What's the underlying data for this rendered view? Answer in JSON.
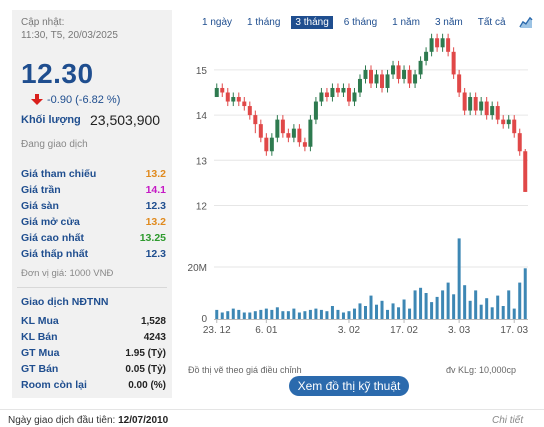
{
  "summary": {
    "updated_label": "Cập nhật:",
    "updated_time": "11:30, T5, 20/03/2025",
    "price": "12.30",
    "change": "-0.90 (-6.82 %)",
    "volume_label": "Khối lượng",
    "volume_value": "23,503,900",
    "status": "Đang giao dịch"
  },
  "prices": [
    {
      "label": "Giá tham chiếu",
      "value": "13.2",
      "color": "#e08a1e"
    },
    {
      "label": "Giá trần",
      "value": "14.1",
      "color": "#c518c5"
    },
    {
      "label": "Giá sàn",
      "value": "12.3",
      "color": "#1f4e8f"
    },
    {
      "label": "Giá mở cửa",
      "value": "13.2",
      "color": "#e08a1e"
    },
    {
      "label": "Giá cao nhất",
      "value": "13.25",
      "color": "#2e9a2e"
    },
    {
      "label": "Giá thấp nhất",
      "value": "12.3",
      "color": "#1f4e8f"
    }
  ],
  "unit_note": "Đơn vị giá: 1000 VNĐ",
  "foreign": {
    "title": "Giao dịch NĐTNN",
    "rows": [
      {
        "label": "KL Mua",
        "value": "1,528"
      },
      {
        "label": "KL Bán",
        "value": "4243"
      },
      {
        "label": "GT Mua",
        "value": "1.95 (Tỷ)"
      },
      {
        "label": "GT Bán",
        "value": "0.05 (Tỷ)"
      },
      {
        "label": "Room còn lại",
        "value": "0.00 (%)"
      }
    ]
  },
  "tabs": [
    {
      "label": "1 ngày",
      "active": false
    },
    {
      "label": "1 tháng",
      "active": false
    },
    {
      "label": "3 tháng",
      "active": true
    },
    {
      "label": "6 tháng",
      "active": false
    },
    {
      "label": "1 năm",
      "active": false
    },
    {
      "label": "3 năm",
      "active": false
    },
    {
      "label": "Tất cả",
      "active": false
    }
  ],
  "chart_icon": "line-chart-icon",
  "chart_data": {
    "type": "candlestick",
    "y_ticks": [
      "15",
      "14",
      "13",
      "12"
    ],
    "y_range": [
      11.9,
      15.75
    ],
    "volume_tick": "20M",
    "volume_zero": "0",
    "volume_max_millions": 35,
    "x_ticks": [
      {
        "label": "23. 12",
        "index": 0
      },
      {
        "label": "6. 01",
        "index": 9
      },
      {
        "label": "3. 02",
        "index": 24
      },
      {
        "label": "17. 02",
        "index": 34
      },
      {
        "label": "3. 03",
        "index": 44
      },
      {
        "label": "17. 03",
        "index": 54
      }
    ],
    "up_color": "#2e7a4f",
    "down_color": "#e04848",
    "volume_color": "#3d87b4",
    "candles": [
      [
        14.4,
        14.6,
        14.4,
        14.7
      ],
      [
        14.6,
        14.5,
        14.4,
        14.7
      ],
      [
        14.5,
        14.3,
        14.2,
        14.6
      ],
      [
        14.3,
        14.4,
        14.2,
        14.5
      ],
      [
        14.4,
        14.3,
        14.2,
        14.5
      ],
      [
        14.3,
        14.2,
        14.1,
        14.4
      ],
      [
        14.2,
        14.0,
        13.9,
        14.3
      ],
      [
        14.0,
        13.8,
        13.6,
        14.1
      ],
      [
        13.8,
        13.5,
        13.4,
        13.9
      ],
      [
        13.5,
        13.2,
        13.1,
        13.6
      ],
      [
        13.2,
        13.5,
        13.1,
        13.6
      ],
      [
        13.5,
        13.9,
        13.4,
        14.0
      ],
      [
        13.9,
        13.6,
        13.5,
        14.0
      ],
      [
        13.6,
        13.5,
        13.4,
        13.7
      ],
      [
        13.5,
        13.7,
        13.4,
        13.8
      ],
      [
        13.7,
        13.4,
        13.3,
        13.8
      ],
      [
        13.4,
        13.3,
        13.2,
        13.5
      ],
      [
        13.3,
        13.9,
        13.2,
        14.0
      ],
      [
        13.9,
        14.3,
        13.8,
        14.4
      ],
      [
        14.3,
        14.5,
        14.2,
        14.6
      ],
      [
        14.5,
        14.4,
        14.3,
        14.6
      ],
      [
        14.4,
        14.6,
        14.3,
        14.7
      ],
      [
        14.6,
        14.5,
        14.4,
        14.7
      ],
      [
        14.5,
        14.6,
        14.4,
        14.7
      ],
      [
        14.6,
        14.3,
        14.2,
        14.7
      ],
      [
        14.3,
        14.5,
        14.2,
        14.6
      ],
      [
        14.5,
        14.8,
        14.4,
        14.9
      ],
      [
        14.8,
        15.0,
        14.7,
        15.1
      ],
      [
        15.0,
        14.7,
        14.6,
        15.1
      ],
      [
        14.7,
        14.9,
        14.6,
        15.0
      ],
      [
        14.9,
        14.6,
        14.5,
        15.0
      ],
      [
        14.6,
        14.9,
        14.5,
        15.0
      ],
      [
        14.9,
        15.1,
        14.8,
        15.2
      ],
      [
        15.1,
        14.8,
        14.7,
        15.2
      ],
      [
        14.8,
        15.0,
        14.7,
        15.1
      ],
      [
        15.0,
        14.7,
        14.6,
        15.1
      ],
      [
        14.7,
        14.9,
        14.6,
        15.0
      ],
      [
        14.9,
        15.2,
        14.8,
        15.3
      ],
      [
        15.2,
        15.4,
        15.1,
        15.5
      ],
      [
        15.4,
        15.7,
        15.3,
        15.8
      ],
      [
        15.7,
        15.5,
        15.4,
        15.8
      ],
      [
        15.5,
        15.7,
        15.4,
        15.8
      ],
      [
        15.7,
        15.4,
        15.3,
        15.8
      ],
      [
        15.4,
        14.9,
        14.8,
        15.5
      ],
      [
        14.9,
        14.5,
        14.4,
        15.0
      ],
      [
        14.5,
        14.1,
        14.0,
        14.6
      ],
      [
        14.1,
        14.4,
        14.0,
        14.5
      ],
      [
        14.4,
        14.1,
        14.0,
        14.5
      ],
      [
        14.1,
        14.3,
        14.0,
        14.4
      ],
      [
        14.3,
        14.0,
        13.9,
        14.4
      ],
      [
        14.0,
        14.2,
        13.9,
        14.3
      ],
      [
        14.2,
        13.9,
        13.8,
        14.3
      ],
      [
        13.9,
        13.8,
        13.7,
        14.0
      ],
      [
        13.8,
        13.9,
        13.7,
        14.0
      ],
      [
        13.9,
        13.6,
        13.5,
        14.0
      ],
      [
        13.6,
        13.2,
        13.1,
        13.7
      ],
      [
        13.2,
        12.3,
        12.3,
        13.25
      ]
    ],
    "volumes": [
      3.5,
      2.5,
      3,
      4,
      3.5,
      2.5,
      2.5,
      3,
      3.5,
      4,
      3.5,
      4.5,
      3,
      3,
      4,
      2.5,
      3,
      3.5,
      4,
      3.5,
      3,
      5,
      3.5,
      2.5,
      3,
      4,
      6,
      5,
      9,
      5.5,
      7,
      3.5,
      6,
      4.5,
      7.5,
      4,
      11,
      12,
      10,
      6.5,
      8.5,
      11,
      14,
      9.5,
      31,
      13,
      7,
      11,
      5.5,
      8,
      4.5,
      9,
      5,
      11,
      4,
      14,
      19.5
    ]
  },
  "footnotes": {
    "left": "Đồ thị vẽ theo giá điều chỉnh",
    "right": "đv KLg: 10,000cp"
  },
  "tech_button": "Xem đồ thị kỹ thuật",
  "first_day": {
    "label": "Ngày giao dịch đầu tiên:",
    "date": "12/07/2010"
  },
  "detail_link": "Chi tiết"
}
